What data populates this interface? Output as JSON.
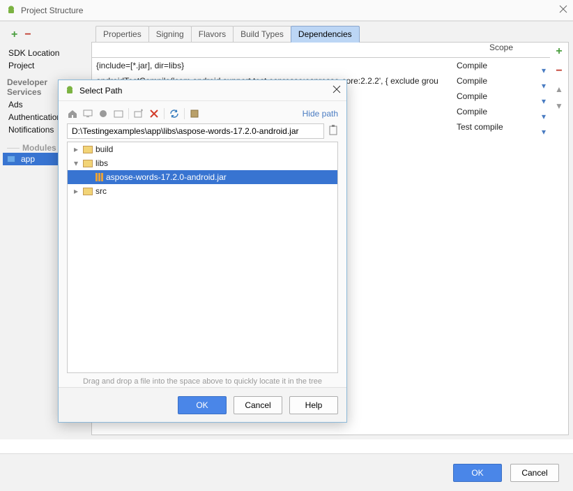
{
  "window": {
    "title": "Project Structure"
  },
  "sidebar": {
    "items": [
      "SDK Location",
      "Project",
      "Developer Services",
      "Ads",
      "Authentication",
      "Notifications"
    ],
    "modules_label": "Modules",
    "selected_module": "app"
  },
  "tabs": [
    "Properties",
    "Signing",
    "Flavors",
    "Build Types",
    "Dependencies"
  ],
  "dep": {
    "scope_header": "Scope",
    "rows": [
      {
        "text": "{include=[*.jar], dir=libs}",
        "scope": "Compile"
      },
      {
        "text": "androidTestCompile('com.android.support.test.espresso:espresso-core:2.2.2', {     exclude grou",
        "scope": "Compile"
      },
      {
        "text": "",
        "scope": "Compile"
      },
      {
        "text": "",
        "scope": "Compile"
      },
      {
        "text": "",
        "scope": "Test compile"
      }
    ]
  },
  "buttons": {
    "ok": "OK",
    "cancel": "Cancel",
    "help": "Help"
  },
  "modal": {
    "title": "Select Path",
    "hide_path": "Hide path",
    "path_value": "D:\\Testingexamples\\app\\libs\\aspose-words-17.2.0-android.jar",
    "tree": {
      "build": "build",
      "libs": "libs",
      "selected": "aspose-words-17.2.0-android.jar",
      "src": "src"
    },
    "hint": "Drag and drop a file into the space above to quickly locate it in the tree"
  }
}
